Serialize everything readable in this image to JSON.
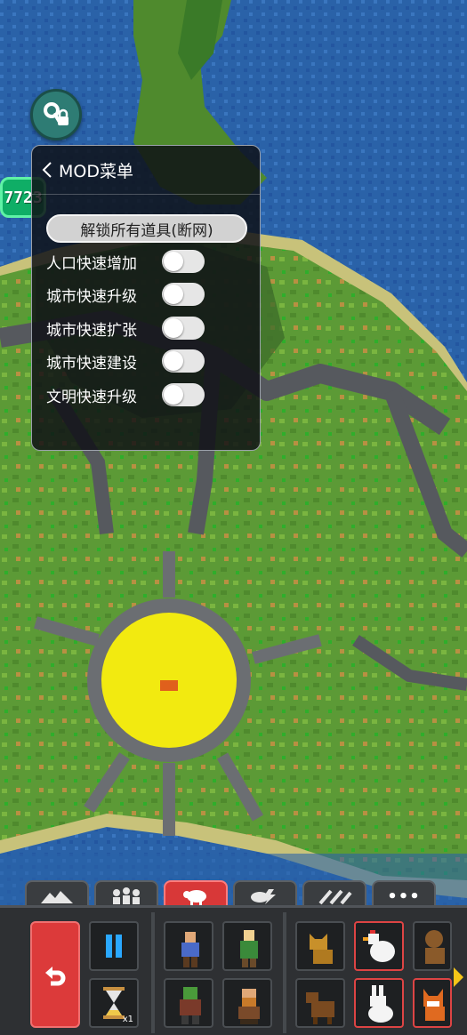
{
  "badge": {
    "value": "7723"
  },
  "mod_menu": {
    "title": "MOD菜单",
    "unlock_button": "解锁所有道具(断网)",
    "options": [
      {
        "label": "人口快速增加",
        "enabled": false
      },
      {
        "label": "城市快速升级",
        "enabled": false
      },
      {
        "label": "城市快速扩张",
        "enabled": false
      },
      {
        "label": "城市快速建设",
        "enabled": false
      },
      {
        "label": "文明快速升级",
        "enabled": false
      }
    ]
  },
  "toolbar": {
    "tabs": [
      {
        "icon": "mountains-icon",
        "active": false
      },
      {
        "icon": "creatures-icon",
        "active": false
      },
      {
        "icon": "sheep-icon",
        "active": true
      },
      {
        "icon": "lightning-icon",
        "active": false
      },
      {
        "icon": "tools-icon",
        "active": false
      },
      {
        "icon": "more-icon",
        "label": "•••",
        "active": false
      }
    ],
    "time_scale": "x1",
    "units": [
      {
        "icon": "human-icon"
      },
      {
        "icon": "elf-icon"
      },
      {
        "icon": "orc-icon"
      },
      {
        "icon": "dwarf-icon"
      }
    ],
    "animals": [
      {
        "icon": "cat-icon"
      },
      {
        "icon": "chicken-icon"
      },
      {
        "icon": "monkey-icon"
      },
      {
        "icon": "dog-icon"
      },
      {
        "icon": "rabbit-icon"
      },
      {
        "icon": "fox-icon"
      }
    ]
  },
  "colors": {
    "ocean": "#2a62a8",
    "grass": "#5c9a36",
    "city_zone": "#f2ea10",
    "panel_bg": "#0e1016",
    "undo": "#dc3a3a",
    "active_tab": "#d83838",
    "badge": "#0fae66"
  }
}
